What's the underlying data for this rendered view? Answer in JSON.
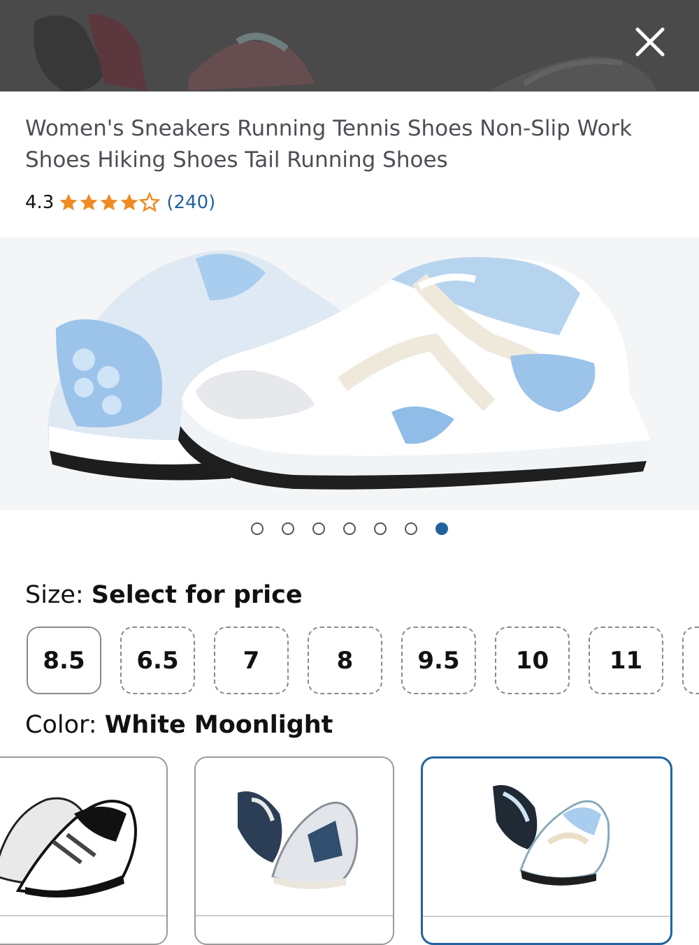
{
  "header": {
    "close_icon": "close-icon"
  },
  "product": {
    "title": "Women's Sneakers Running Tennis Shoes Non-Slip Work Shoes Hiking Shoes Tail Running Shoes",
    "rating": "4.3",
    "rating_stars": 4.3,
    "review_count": "(240)"
  },
  "gallery": {
    "total": 7,
    "active_index": 6
  },
  "size": {
    "label": "Size: ",
    "value": "Select for price",
    "options": [
      "8.5",
      "6.5",
      "7",
      "8",
      "9.5",
      "10",
      "11"
    ],
    "selected": "8.5"
  },
  "color": {
    "label": "Color: ",
    "value": "White Moonlight",
    "swatches": [
      "black-white",
      "grey-navy",
      "white-moonlight"
    ],
    "selected": "white-moonlight"
  },
  "colors": {
    "accent": "#2162a1",
    "star": "#f08a24",
    "topbar": "#4a4a4a"
  }
}
